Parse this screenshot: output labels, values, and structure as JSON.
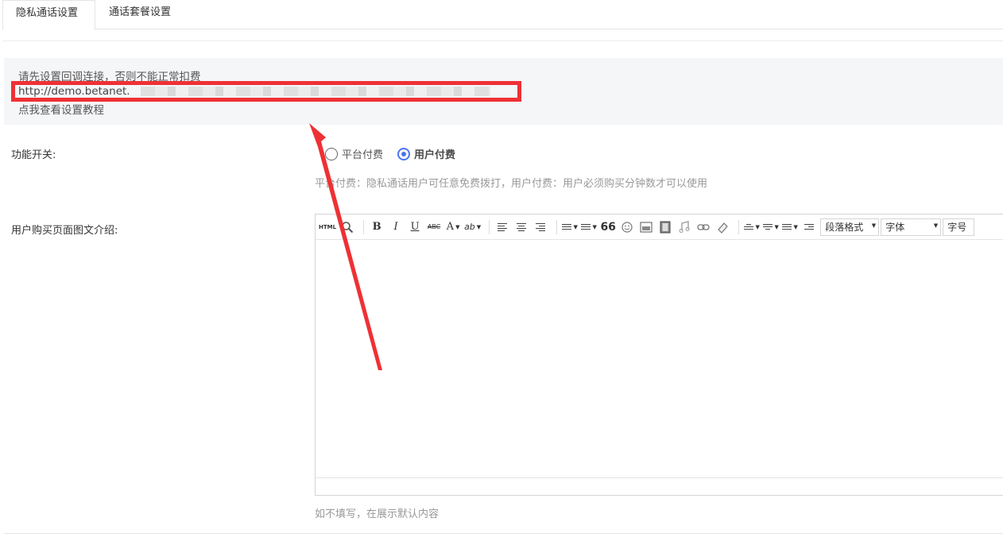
{
  "tabs": [
    {
      "label": "隐私通话设置",
      "active": true
    },
    {
      "label": "通话套餐设置",
      "active": false
    }
  ],
  "notice": {
    "line1": "请先设置回调连接，否则不能正常扣费",
    "url": "http://demo.betanet.",
    "line3": "点我查看设置教程"
  },
  "form": {
    "switch_label": "功能开关:",
    "options": [
      {
        "label": "平台付费",
        "checked": false
      },
      {
        "label": "用户付费",
        "checked": true
      }
    ],
    "switch_hint": "平台付费：隐私通话用户可任意免费拨打，用户付费：用户必须购买分钟数才可以使用",
    "intro_label": "用户购买页面图文介绍:",
    "intro_hint": "如不填写，在展示默认内容"
  },
  "editor": {
    "html_label": "HTML",
    "bold": "B",
    "italic": "I",
    "underline": "U",
    "strike": "ABC",
    "font_color": "A",
    "highlight": "ab",
    "quote": "66",
    "paragraph_select": "段落格式",
    "font_select": "字体",
    "size_select": "字号"
  },
  "colors": {
    "accent": "#4a73f0",
    "annotation": "#ee3135",
    "notice_bg": "#f5f6f8"
  }
}
